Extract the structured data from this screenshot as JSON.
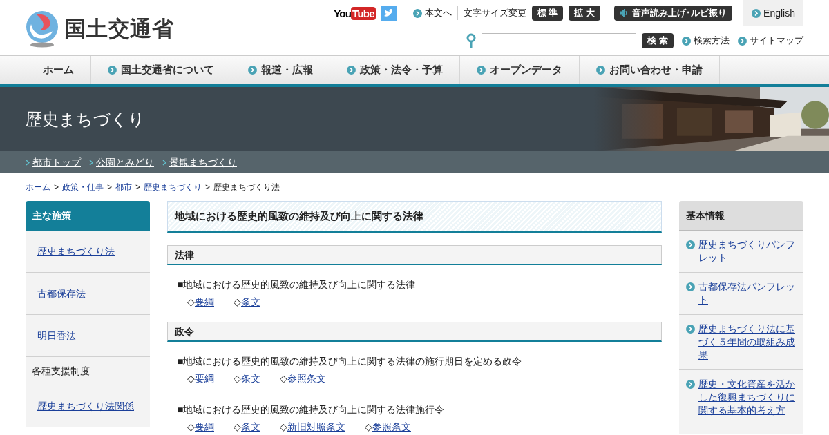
{
  "header": {
    "logo_text": "国土交通省",
    "youtube": {
      "left": "You",
      "right": "Tube"
    },
    "skip_link": "本文へ",
    "font_size": {
      "label": "文字サイズ変更",
      "buttons": [
        "標 準",
        "拡 大"
      ]
    },
    "voice_button": "音声読み上げ･ルビ振り",
    "english": "English",
    "search": {
      "button": "検 索"
    },
    "search_links": [
      "検索方法",
      "サイトマップ"
    ]
  },
  "nav": [
    {
      "label": "ホーム",
      "kind": "plain"
    },
    {
      "label": "国土交通省について",
      "kind": "chevron"
    },
    {
      "label": "報道・広報",
      "kind": "chevron"
    },
    {
      "label": "政策・法令・予算",
      "kind": "chevron"
    },
    {
      "label": "オープンデータ",
      "kind": "chevron"
    },
    {
      "label": "お問い合わせ・申請",
      "kind": "chevron"
    }
  ],
  "banner": {
    "title": "歴史まちづくり"
  },
  "subnav": [
    "都市トップ",
    "公園とみどり",
    "景観まちづくり"
  ],
  "breadcrumb_separator": ">",
  "breadcrumb": [
    {
      "label": "ホーム",
      "link": true
    },
    {
      "label": "政策・仕事",
      "link": true
    },
    {
      "label": "都市",
      "link": true
    },
    {
      "label": "歴史まちづくり",
      "link": true
    },
    {
      "label": "歴史まちづくり法",
      "link": false
    }
  ],
  "left_sidebar": {
    "title": "主な施策",
    "items": [
      {
        "label": "歴史まちづくり法",
        "kind": "link"
      },
      {
        "label": "古都保存法",
        "kind": "link"
      },
      {
        "label": "明日香法",
        "kind": "link"
      },
      {
        "label": "各種支援制度",
        "kind": "heading"
      },
      {
        "label": "歴史まちづくり法関係",
        "kind": "link"
      }
    ]
  },
  "content": {
    "link_bullet": "◇",
    "title": "地域における歴史的風致の維持及び向上に関する法律",
    "sections": [
      {
        "heading": "法律",
        "entries": [
          {
            "text": "■地域における歴史的風致の維持及び向上に関する法律",
            "links": [
              "要綱",
              "条文"
            ]
          }
        ]
      },
      {
        "heading": "政令",
        "entries": [
          {
            "text": "■地域における歴史的風致の維持及び向上に関する法律の施行期日を定める政令",
            "links": [
              "要綱",
              "条文",
              "参照条文"
            ]
          },
          {
            "text": "■地域における歴史的風致の維持及び向上に関する法律施行令",
            "links": [
              "要綱",
              "条文",
              "新旧対照条文",
              "参照条文"
            ]
          }
        ]
      }
    ]
  },
  "right_sidebar": {
    "title": "基本情報",
    "items": [
      "歴史まちづくりパンフレット",
      "古都保存法パンフレット",
      "歴史まちづくり法に基づく５年間の取組み成果",
      "歴史・文化資産を活かした復興まちづくりに関する基本的考え方"
    ]
  }
}
